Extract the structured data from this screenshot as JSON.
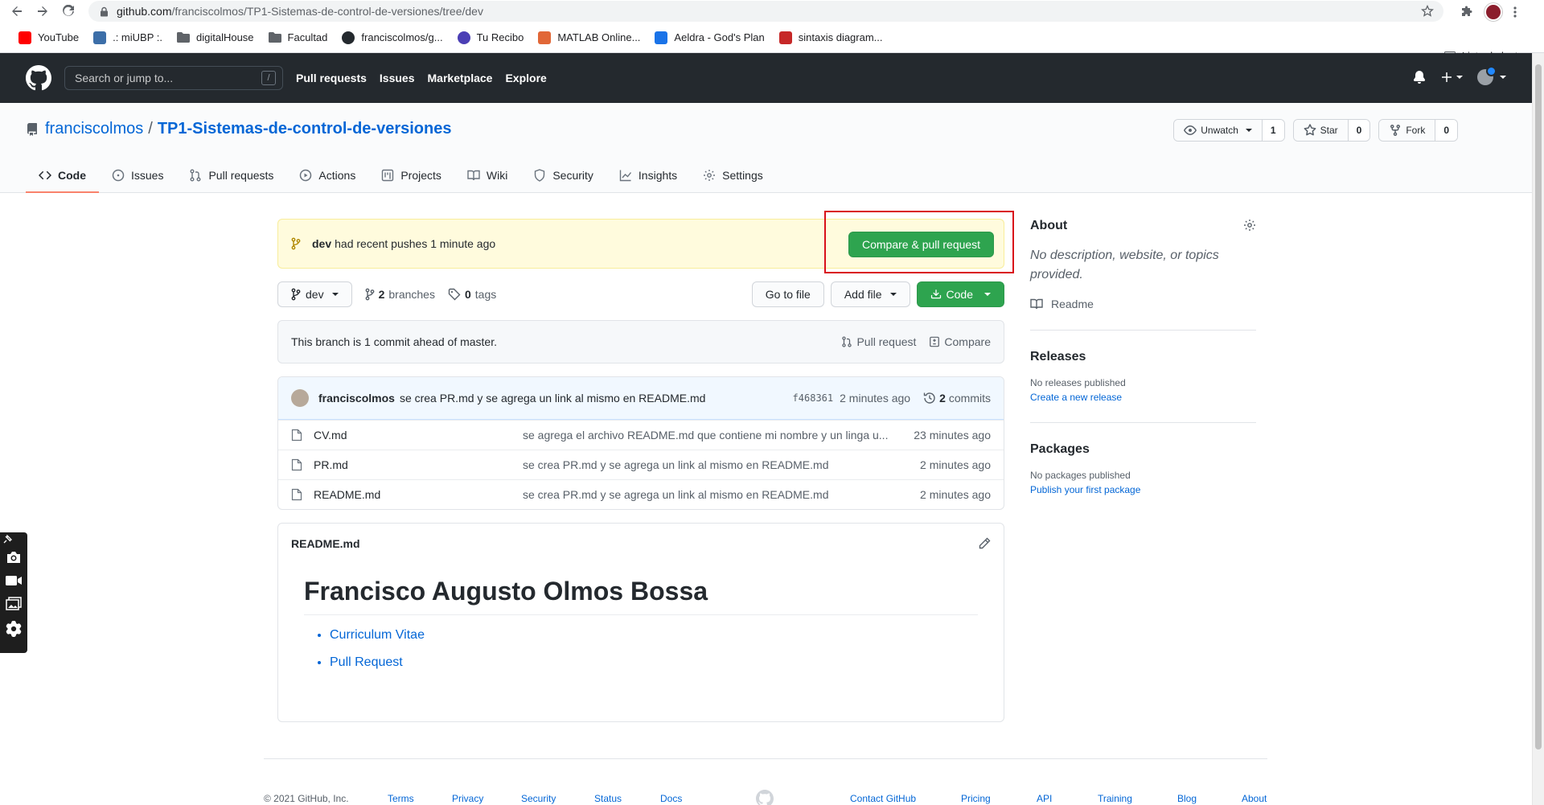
{
  "browser": {
    "url_host": "github.com",
    "url_path": "/franciscolmos/TP1-Sistemas-de-control-de-versiones/tree/dev",
    "bookmarks": [
      {
        "label": "YouTube",
        "color": "#ff0000"
      },
      {
        "label": ".: miUBP :.",
        "color": "#3c6ea8"
      },
      {
        "label": "digitalHouse",
        "color": "#5f6368"
      },
      {
        "label": "Facultad",
        "color": "#5f6368"
      },
      {
        "label": "franciscolmos/g...",
        "color": "#24292e"
      },
      {
        "label": "Tu Recibo",
        "color": "#4b3fb5"
      },
      {
        "label": "MATLAB Online...",
        "color": "#e16737"
      },
      {
        "label": "Aeldra - God's Plan",
        "color": "#1a73e8"
      },
      {
        "label": "sintaxis diagram...",
        "color": "#c62828"
      }
    ],
    "reading_list": "Lista de lectura"
  },
  "header": {
    "search_placeholder": "Search or jump to...",
    "search_shortcut": "/",
    "nav": [
      "Pull requests",
      "Issues",
      "Marketplace",
      "Explore"
    ]
  },
  "repo": {
    "owner": "franciscolmos",
    "separator": "/",
    "name": "TP1-Sistemas-de-control-de-versiones",
    "watch_label": "Unwatch",
    "watch_count": "1",
    "star_label": "Star",
    "star_count": "0",
    "fork_label": "Fork",
    "fork_count": "0",
    "tabs": [
      "Code",
      "Issues",
      "Pull requests",
      "Actions",
      "Projects",
      "Wiki",
      "Security",
      "Insights",
      "Settings"
    ]
  },
  "flash": {
    "branch": "dev",
    "message": "had recent pushes 1 minute ago",
    "button": "Compare & pull request"
  },
  "file_nav": {
    "branch": "dev",
    "branches_count": "2",
    "branches_label": "branches",
    "tags_count": "0",
    "tags_label": "tags",
    "go_to_file": "Go to file",
    "add_file": "Add file",
    "code": "Code"
  },
  "ahead": {
    "text": "This branch is 1 commit ahead of master.",
    "pull_request": "Pull request",
    "compare": "Compare"
  },
  "latest_commit": {
    "author": "franciscolmos",
    "message": "se crea PR.md y se agrega un link al mismo en README.md",
    "sha": "f468361",
    "age": "2 minutes ago",
    "commits_count": "2",
    "commits_label": "commits"
  },
  "files": [
    {
      "name": "CV.md",
      "message": "se agrega el archivo README.md que contiene mi nombre y un linga u...",
      "age": "23 minutes ago"
    },
    {
      "name": "PR.md",
      "message": "se crea PR.md y se agrega un link al mismo en README.md",
      "age": "2 minutes ago"
    },
    {
      "name": "README.md",
      "message": "se crea PR.md y se agrega un link al mismo en README.md",
      "age": "2 minutes ago"
    }
  ],
  "readme": {
    "filename": "README.md",
    "heading": "Francisco Augusto Olmos Bossa",
    "links": [
      "Curriculum Vitae",
      "Pull Request"
    ]
  },
  "sidebar": {
    "about_title": "About",
    "about_text": "No description, website, or topics provided.",
    "readme_label": "Readme",
    "releases_title": "Releases",
    "releases_text": "No releases published",
    "releases_link": "Create a new release",
    "packages_title": "Packages",
    "packages_text": "No packages published",
    "packages_link": "Publish your first package"
  },
  "footer": {
    "copyright": "© 2021 GitHub, Inc.",
    "links_left": [
      "Terms",
      "Privacy",
      "Security",
      "Status",
      "Docs"
    ],
    "links_right": [
      "Contact GitHub",
      "Pricing",
      "API",
      "Training",
      "Blog",
      "About"
    ]
  },
  "colors": {
    "header_bg": "#24292e",
    "primary_green": "#2ea44f",
    "link_blue": "#0366d6",
    "flash_bg": "#fffbdd",
    "highlight_red": "#d9101a",
    "active_tab_underline": "#f9826c"
  }
}
